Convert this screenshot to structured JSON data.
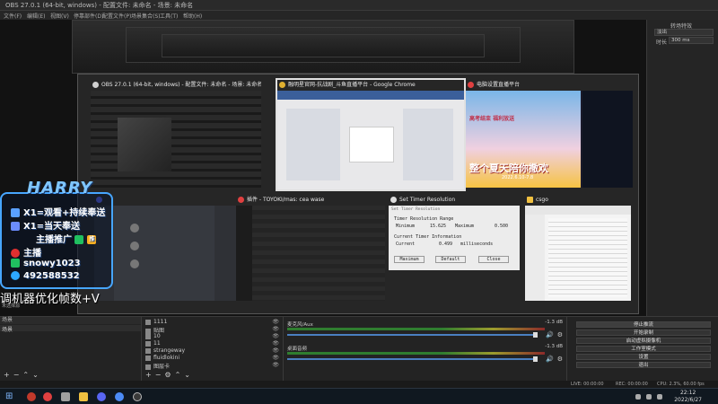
{
  "window": {
    "title": "OBS 27.0.1 (64-bit, windows) - 配置文件: 未命名 - 场景: 未命名"
  },
  "menu": [
    "文件(F)",
    "编辑(E)",
    "视图(V)",
    "停靠部件(D)",
    "配置文件(P)",
    "场景集合(S)",
    "工具(T)",
    "帮助(H)"
  ],
  "right_panel": {
    "title": "转场特效",
    "select_value": "淡出",
    "duration_label": "时长",
    "duration_value": "300 ms"
  },
  "switcher": {
    "windows": [
      {
        "title": "OBS 27.0.1 (64-bit, windows) - 配置文件: 未命名 - 场景: 未命名",
        "icon_color": "#d0d0d0"
      },
      {
        "title": "融明星官网-抗战剧_斗鱼直播平台 - Google Chrome",
        "icon_color": "#e0b030",
        "selected": true
      },
      {
        "title": "电脑设置直播平台",
        "icon_color": "#e04040"
      },
      {
        "title": "",
        "icon_color": "#5865f2"
      },
      {
        "title": "插件 - TOYOKI/mas: cea wase",
        "icon_color": "#e04040"
      },
      {
        "title": "Set Timer Resolution",
        "icon_color": "#dddddd"
      },
      {
        "title": "csgo",
        "icon_color": "#f0c040"
      }
    ],
    "timer_dialog": {
      "header": "Set Timer Resolution",
      "range_label": "Timer Resolution Range",
      "min_label": "Minimum",
      "min_value": "15.625",
      "max_label": "Maximum",
      "max_value": "0.500",
      "current_label": "Current Timer Information",
      "cur_label": "Current",
      "cur_value": "0.499",
      "cur_unit": "milliseconds",
      "btn_max": "Maximum",
      "btn_default": "Default",
      "btn_close": "Close"
    },
    "banner_text": "高考结束 福利放送",
    "banner_big": "整个夏天陪你撒欢",
    "banner_date": "2022.6.10-7.8"
  },
  "overlay": {
    "logo": "HARRY",
    "rows": [
      {
        "text": "X1=观看+持续奉送",
        "color": "#5aa0ff"
      },
      {
        "text": "X1=当天奉送",
        "color": "#6b8cff"
      },
      {
        "text": "主播推广",
        "color": "#ffb020",
        "badge": "推"
      },
      {
        "text": "主播",
        "color": "#e03030"
      },
      {
        "text": "snowy1023",
        "color": "#20c060"
      },
      {
        "text": "492588532",
        "color": "#2da8ff"
      }
    ],
    "caption": "调机器优化帧数+V",
    "subcaption": "未选择源"
  },
  "docks": {
    "scenes": {
      "header": "场景",
      "item": "场景"
    },
    "sources": {
      "header": "",
      "items": [
        "1111",
        "贴图",
        "10",
        "11",
        "strangeway",
        "fluidlokini",
        "图层卡"
      ]
    },
    "mixer": {
      "rows": [
        {
          "name": "麦克风/Aux",
          "db": "-1.3 dB"
        },
        {
          "name": "桌面音频",
          "db": "-1.3 dB"
        }
      ]
    },
    "controls": {
      "buttons": [
        "停止推流",
        "开始录制",
        "启动虚拟摄像机",
        "工作室模式",
        "设置",
        "退出"
      ]
    }
  },
  "status": {
    "left": "",
    "live": "LIVE: 00:00:00",
    "rec": "REC: 00:00:00",
    "cpu": "CPU: 2.3%, 60.00 fps"
  },
  "clock": {
    "time": "22:12",
    "date": "2022/6/27"
  }
}
